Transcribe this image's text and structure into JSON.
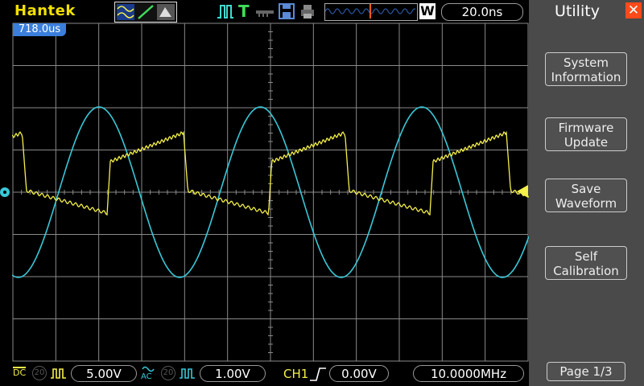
{
  "header": {
    "brand": "Hantek",
    "run_status_letter": "T",
    "acquire_mode_letter": "W",
    "timebase": "20.0ns"
  },
  "trigger_position": "718.0us",
  "panel": {
    "title": "Utility",
    "close_symbol": "✕",
    "buttons": [
      {
        "line1": "System",
        "line2": "Information"
      },
      {
        "line1": "Firmware",
        "line2": "Update"
      },
      {
        "line1": "Save",
        "line2": "Waveform"
      },
      {
        "line1": "Self",
        "line2": "Calibration"
      }
    ],
    "page": "Page 1/3"
  },
  "footer": {
    "ch1_coupling": "DC",
    "ch1_volts": "5.00V",
    "ch2_coupling": "AC",
    "ch2_volts": "1.00V",
    "ch1_bw": "20",
    "ch2_bw": "20",
    "trigger_source": "CH1",
    "trigger_level": "0.00V",
    "frequency": "10.0000MHz"
  },
  "colors": {
    "ch1": "#f5f04a",
    "ch2": "#39c8d8",
    "grid": "#8a8a8a",
    "panel": "#4a4a4a",
    "brand": "#f2e000",
    "accent": "#ff4a1a"
  }
}
